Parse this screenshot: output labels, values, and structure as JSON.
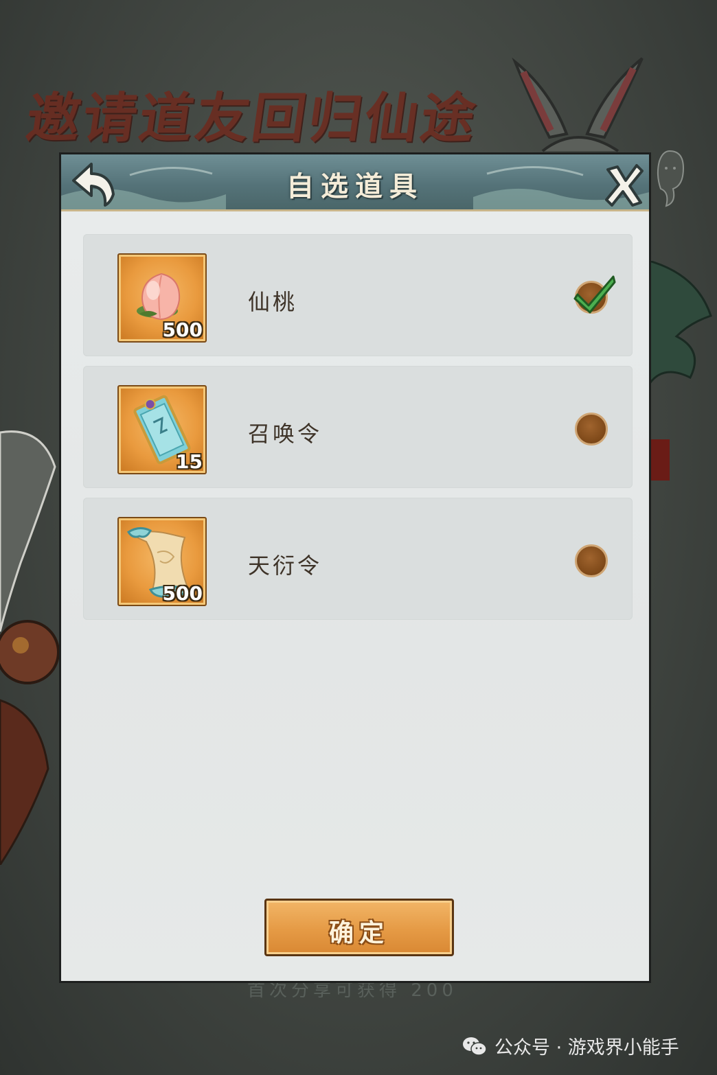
{
  "background": {
    "banner_title": "邀请道友回归仙途",
    "footer_text": "首次分享可获得 200"
  },
  "dialog": {
    "title": "自选道具",
    "back_icon": "back-arrow-icon",
    "close_icon": "close-icon",
    "items": [
      {
        "name": "仙桃",
        "count": "500",
        "icon": "peach-icon",
        "selected": true
      },
      {
        "name": "召唤令",
        "count": "15",
        "icon": "summon-token-icon",
        "selected": false
      },
      {
        "name": "天衍令",
        "count": "500",
        "icon": "scroll-icon",
        "selected": false
      }
    ],
    "confirm_label": "确定"
  },
  "watermark": {
    "text": "公众号 · 游戏界小能手",
    "icon": "wechat-icon"
  },
  "colors": {
    "header": "#557379",
    "panel": "#e6e9e8",
    "item_frame": "#e99a3e",
    "radio": "#7d4818",
    "check": "#4caf50"
  }
}
